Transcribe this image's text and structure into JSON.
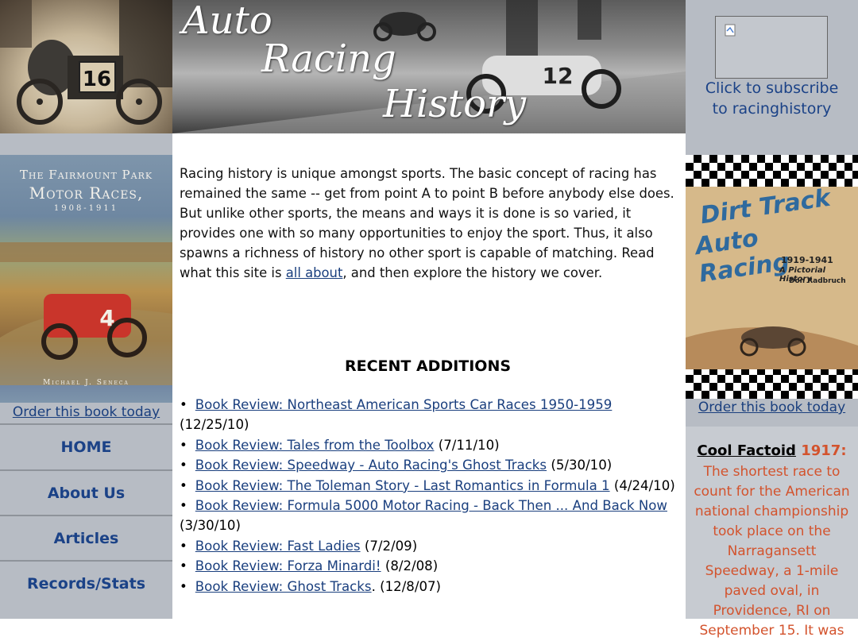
{
  "header": {
    "banner_words": [
      "Auto",
      "Racing",
      "History"
    ],
    "car_numbers": [
      "16",
      "12"
    ]
  },
  "left": {
    "book_title_line1": "The Fairmount Park",
    "book_title_line2": "Motor Races,",
    "book_years": "1908-1911",
    "book_author": "Michael J. Seneca",
    "car_number": "4",
    "order_link": "Order this book today"
  },
  "nav": [
    {
      "label": "HOME"
    },
    {
      "label": "About Us"
    },
    {
      "label": "Articles"
    },
    {
      "label": "Records/Stats"
    }
  ],
  "right": {
    "subscribe_line1": "Click to subscribe",
    "subscribe_line2": "to racinghistory",
    "book_title_line1": "Dirt Track",
    "book_title_line2": "Auto Racing",
    "book_years": "1919-1941",
    "book_subtitle": "A Pictorial History",
    "book_author": "Don Radbruch",
    "order_link": "Order this book today"
  },
  "factoid": {
    "label": "Cool Factoid",
    "year": "1917:",
    "body": "The shortest race to count for the American national championship took place on the Narragansett Speedway, a 1-mile paved oval, in Providence, RI on September 15. It was"
  },
  "intro": {
    "text_before": "Racing history is unique amongst sports. The basic concept of racing has remained the same -- get from point A to point B before anybody else does. But unlike other sports, the means and ways it is done is so varied, it provides one with so many opportunities to enjoy the sport. Thus, it also spawns a richness of history no other sport is capable of matching. Read what this site is ",
    "link": "all about",
    "text_after": ", and then explore the history we cover."
  },
  "recent": {
    "heading": "RECENT ADDITIONS",
    "items": [
      {
        "link": "Book Review: Northeast American Sports Car Races 1950-1959",
        "date": "(12/25/10)"
      },
      {
        "link": "Book Review: Tales from the Toolbox",
        "date": "(7/11/10)"
      },
      {
        "link": "Book Review: Speedway - Auto Racing's Ghost Tracks",
        "date": "(5/30/10)"
      },
      {
        "link": "Book Review: The Toleman Story - Last Romantics in Formula 1",
        "date": "(4/24/10)"
      },
      {
        "link": "Book Review: Formula 5000 Motor Racing - Back Then ... And Back Now",
        "date": "(3/30/10)"
      },
      {
        "link": "Book Review: Fast Ladies",
        "date": "(7/2/09)"
      },
      {
        "link": "Book Review: Forza Minardi!",
        "date": "(8/2/08)"
      },
      {
        "link": "Book Review: Ghost Tracks",
        "date": ". (12/8/07)"
      }
    ]
  }
}
